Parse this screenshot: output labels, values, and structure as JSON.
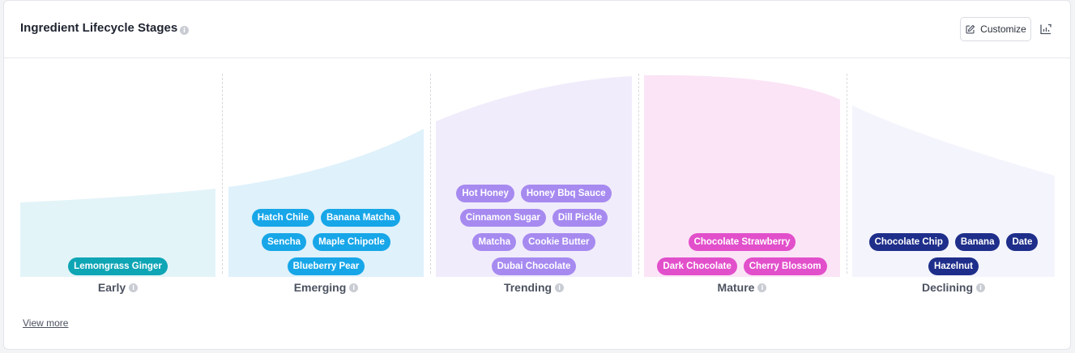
{
  "header": {
    "title": "Ingredient Lifecycle Stages",
    "customize_label": "Customize"
  },
  "stages": [
    {
      "name": "Early",
      "tags": [
        "Lemongrass Ginger"
      ],
      "fill_color": "#e3f4f8",
      "tag_color": "#0ea5b5"
    },
    {
      "name": "Emerging",
      "tags": [
        "Hatch Chile",
        "Banana Matcha",
        "Sencha",
        "Maple Chipotle",
        "Blueberry Pear"
      ],
      "fill_color": "#dff1fb",
      "tag_color": "#17a6e8"
    },
    {
      "name": "Trending",
      "tags": [
        "Hot Honey",
        "Honey Bbq Sauce",
        "Cinnamon Sugar",
        "Dill Pickle",
        "Matcha",
        "Cookie Butter",
        "Dubai Chocolate"
      ],
      "fill_color": "#f1ecfb",
      "tag_color": "#a68af0"
    },
    {
      "name": "Mature",
      "tags": [
        "Chocolate Strawberry",
        "Dark Chocolate",
        "Cherry Blossom"
      ],
      "fill_color": "#fbe4f6",
      "tag_color": "#e24fcb"
    },
    {
      "name": "Declining",
      "tags": [
        "Chocolate Chip",
        "Banana",
        "Date",
        "Hazelnut"
      ],
      "fill_color": "#f4f4fd",
      "tag_color": "#1e2e8a"
    }
  ],
  "footer": {
    "view_more_label": "View more"
  }
}
